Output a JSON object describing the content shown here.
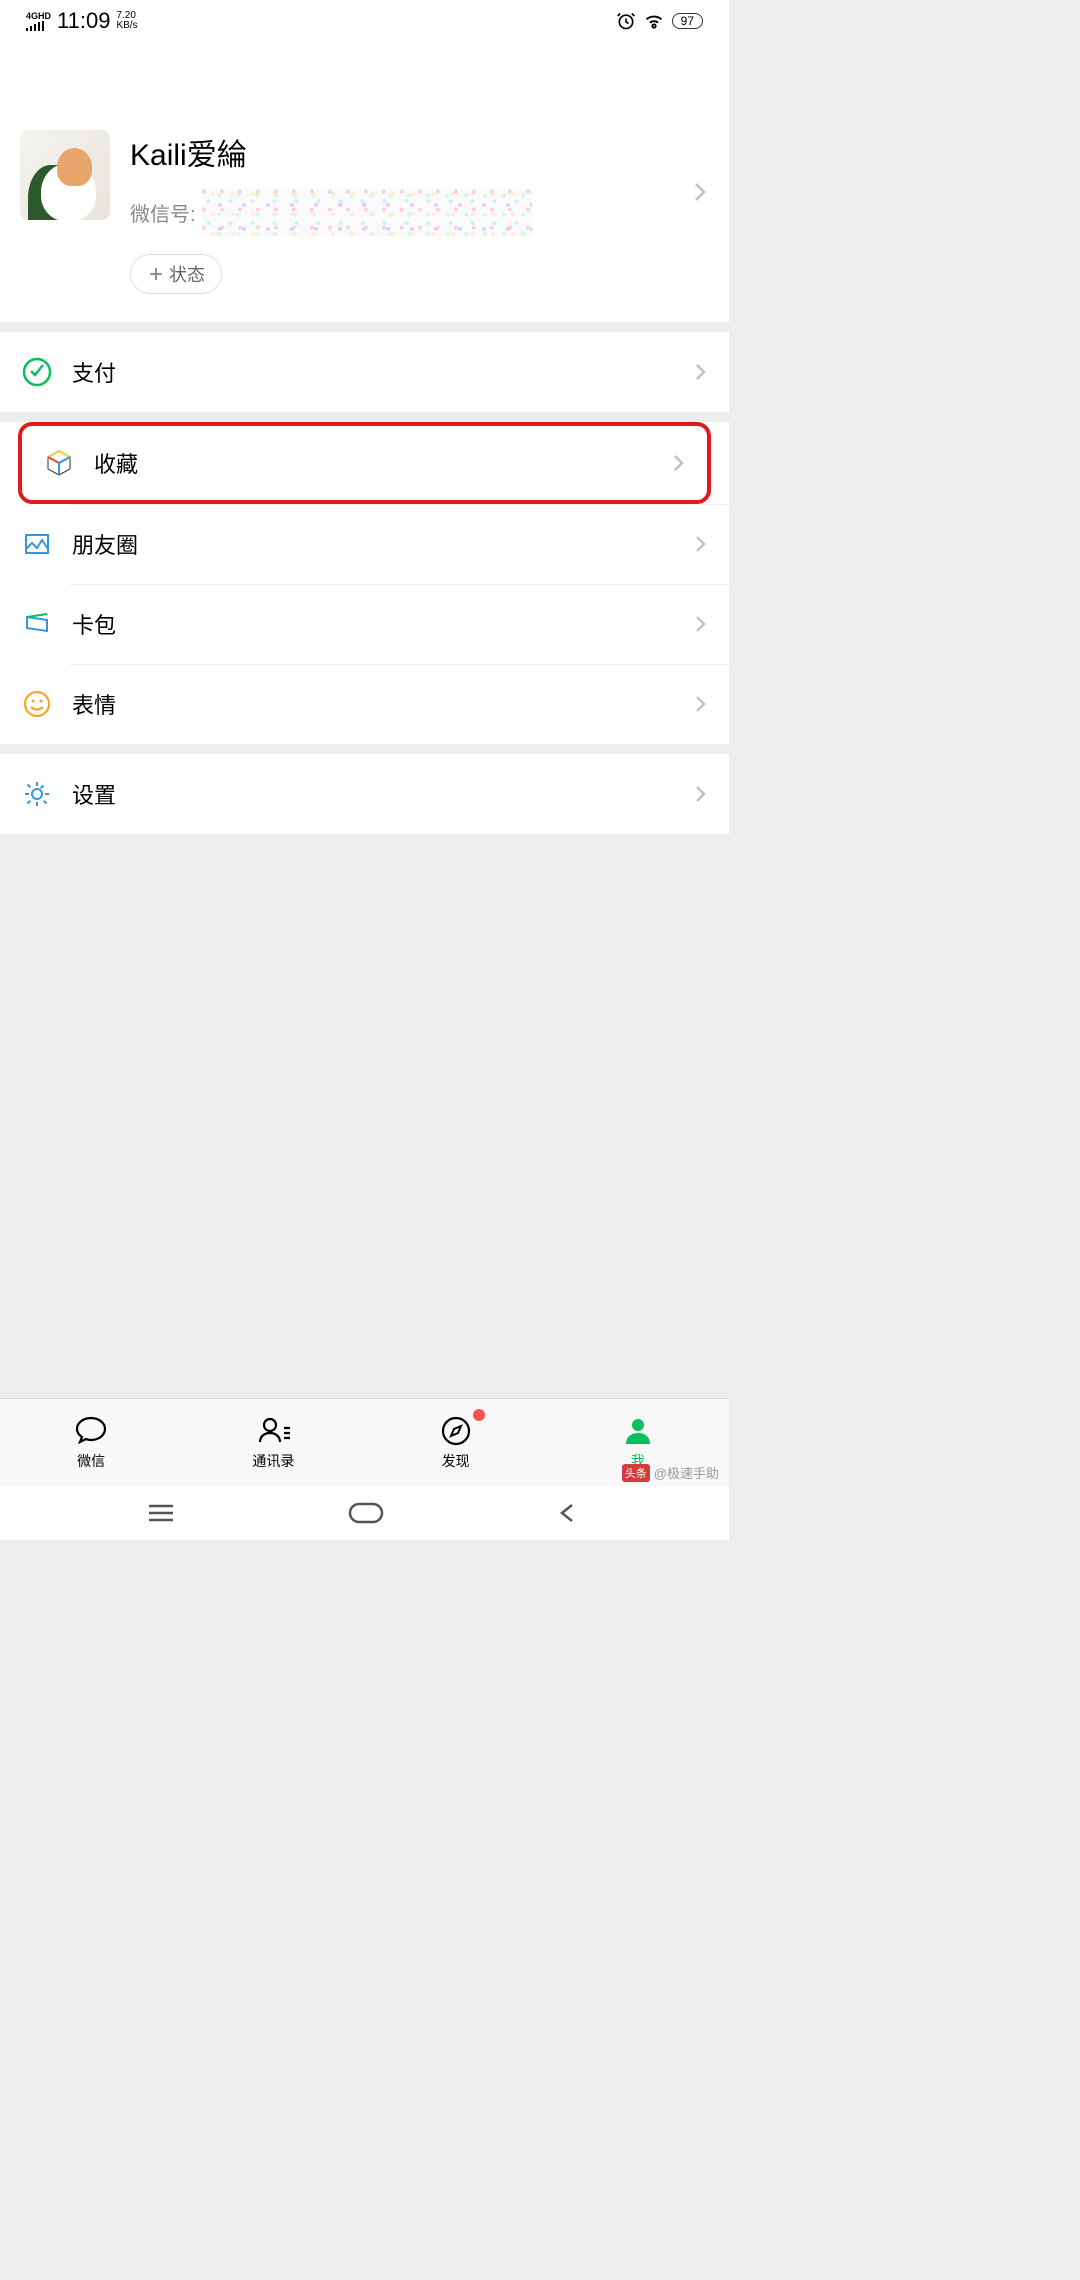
{
  "status": {
    "network": "4GHD",
    "time": "11:09",
    "speed_top": "7.20",
    "speed_bot": "KB/s",
    "battery": "97"
  },
  "profile": {
    "nickname": "Kaili爱綸",
    "id_label": "微信号:",
    "status_btn": "状态"
  },
  "menu": {
    "pay": "支付",
    "favorites": "收藏",
    "moments": "朋友圈",
    "cards": "卡包",
    "stickers": "表情",
    "settings": "设置"
  },
  "nav": {
    "chats": "微信",
    "contacts": "通讯录",
    "discover": "发现",
    "me": "我"
  },
  "watermark": {
    "logo": "头条",
    "text": "@极速手助"
  }
}
